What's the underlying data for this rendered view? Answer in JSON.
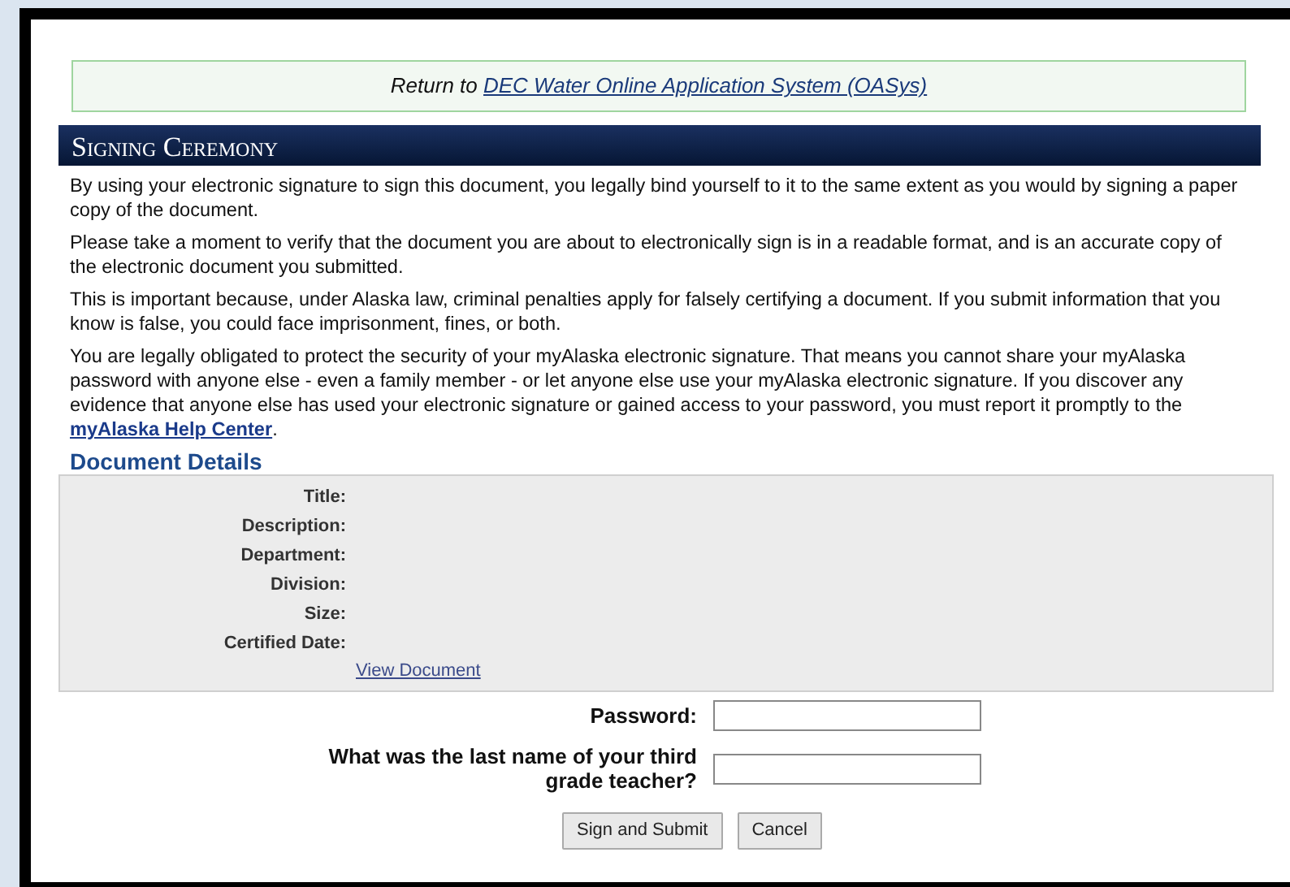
{
  "return_notice": {
    "text": "Return to",
    "link": "DEC Water Online Application System (OASys)"
  },
  "section_title": "Signing Ceremony",
  "paragraphs": [
    {
      "text": "By using your electronic signature to sign this document, you legally bind yourself to it to the same extent as you would by signing a paper copy of the document."
    },
    {
      "text": "Please take a moment to verify that the document you are about to electronically sign is in a readable format, and is an accurate copy of the electronic document you submitted."
    },
    {
      "text": "This is important because, under Alaska law, criminal penalties apply for falsely certifying a document. If you submit information that you know is false, you could face imprisonment, fines, or both."
    },
    {
      "text": "You are legally obligated to protect the security of your myAlaska electronic signature. That means you cannot share your myAlaska password with anyone else - even a family member - or let anyone else use your myAlaska electronic signature. If you discover any evidence that anyone else has used your electronic signature or gained access to your password, you must report it promptly to the",
      "link": "myAlaska Help Center",
      "after": "."
    }
  ],
  "document_details": {
    "heading": "Document Details",
    "fields": [
      {
        "label": "Title:"
      },
      {
        "label": "Description:"
      },
      {
        "label": "Department:"
      },
      {
        "label": "Division:"
      },
      {
        "label": "Size:"
      },
      {
        "label": "Certified Date:"
      }
    ],
    "link": "View Document"
  },
  "form": {
    "fields": [
      {
        "label": "Password:"
      },
      {
        "label": "What was the last name of your third grade teacher?"
      }
    ],
    "buttons": [
      "Sign and Submit",
      "Cancel"
    ]
  }
}
